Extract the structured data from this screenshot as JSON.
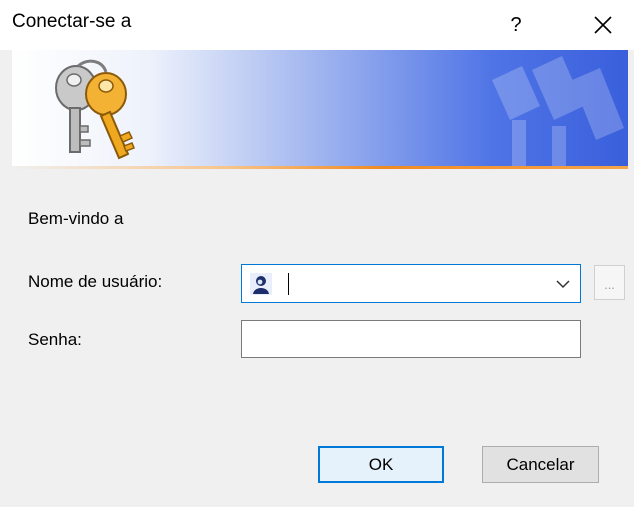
{
  "window": {
    "title": "Conectar-se a",
    "help_label": "?"
  },
  "banner": {
    "icon": "keys-icon",
    "accent_color": "#3a5fdc",
    "stripe_color": "#f08a24"
  },
  "form": {
    "welcome": "Bem-vindo a",
    "username_label": "Nome de usuário:",
    "username_value": "",
    "browse_label": "...",
    "password_label": "Senha:",
    "password_value": ""
  },
  "buttons": {
    "ok": "OK",
    "cancel": "Cancelar"
  }
}
